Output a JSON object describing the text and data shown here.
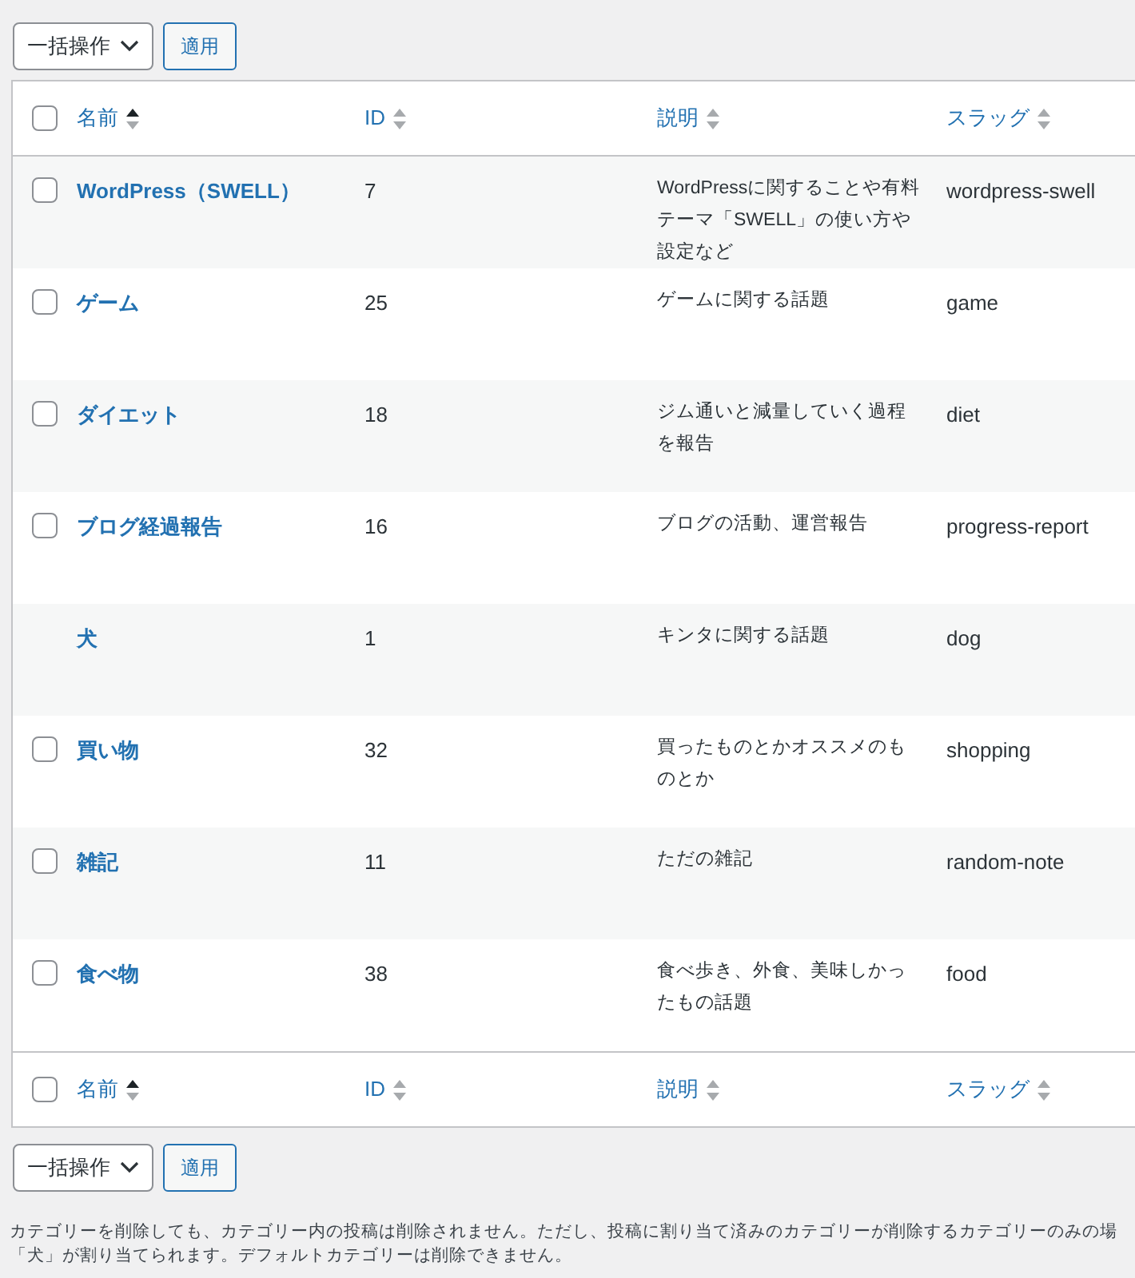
{
  "bulk_actions_top": {
    "select": "一括操作",
    "apply": "適用"
  },
  "table": {
    "select_all_checked": false,
    "columns": [
      {
        "label": "名前",
        "sorted": true
      },
      {
        "label": "ID",
        "sorted": false
      },
      {
        "label": "説明",
        "sorted": false
      },
      {
        "label": "スラッグ",
        "sorted": false
      }
    ],
    "rows": [
      {
        "name": "WordPress（SWELL）",
        "id": "7",
        "description": "WordPressに関することや有料テーマ「SWELL」の使い方や設定など",
        "slug": "wordpress-swell",
        "kind": "checkbox",
        "checked": false
      },
      {
        "name": "ゲーム",
        "id": "25",
        "description": "ゲームに関する話題",
        "slug": "game",
        "kind": "checkbox",
        "checked": false
      },
      {
        "name": "ダイエット",
        "id": "18",
        "description": "ジム通いと減量していく過程を報告",
        "slug": "diet",
        "kind": "checkbox",
        "checked": false
      },
      {
        "name": "ブログ経過報告",
        "id": "16",
        "description": "ブログの活動、運営報告",
        "slug": "progress-report",
        "kind": "checkbox",
        "checked": false
      },
      {
        "name": "犬",
        "id": "1",
        "description": "キンタに関する話題",
        "slug": "dog",
        "kind": "plain"
      },
      {
        "name": "買い物",
        "id": "32",
        "description": "買ったものとかオススメのものとか",
        "slug": "shopping",
        "kind": "checkbox",
        "checked": false
      },
      {
        "name": "雑記",
        "id": "11",
        "description": "ただの雑記",
        "slug": "random-note",
        "kind": "checkbox",
        "checked": false
      },
      {
        "name": "食べ物",
        "id": "38",
        "description": "食べ歩き、外食、美味しかったもの話題",
        "slug": "food",
        "kind": "checkbox",
        "checked": false
      }
    ],
    "footer_select_all_checked": false,
    "footer_columns": [
      {
        "label": "名前",
        "sorted": true
      },
      {
        "label": "ID",
        "sorted": false
      },
      {
        "label": "説明",
        "sorted": false
      },
      {
        "label": "スラッグ",
        "sorted": false
      }
    ]
  },
  "bulk_actions_bottom": {
    "select": "一括操作",
    "apply": "適用"
  },
  "note": [
    "カテゴリーを削除しても、カテゴリー内の投稿は削除されません。ただし、投稿に割り当て済みのカテゴリーが削除するカテゴリーのみの場",
    "「犬」が割り当てられます。デフォルトカテゴリーは削除できません。"
  ]
}
